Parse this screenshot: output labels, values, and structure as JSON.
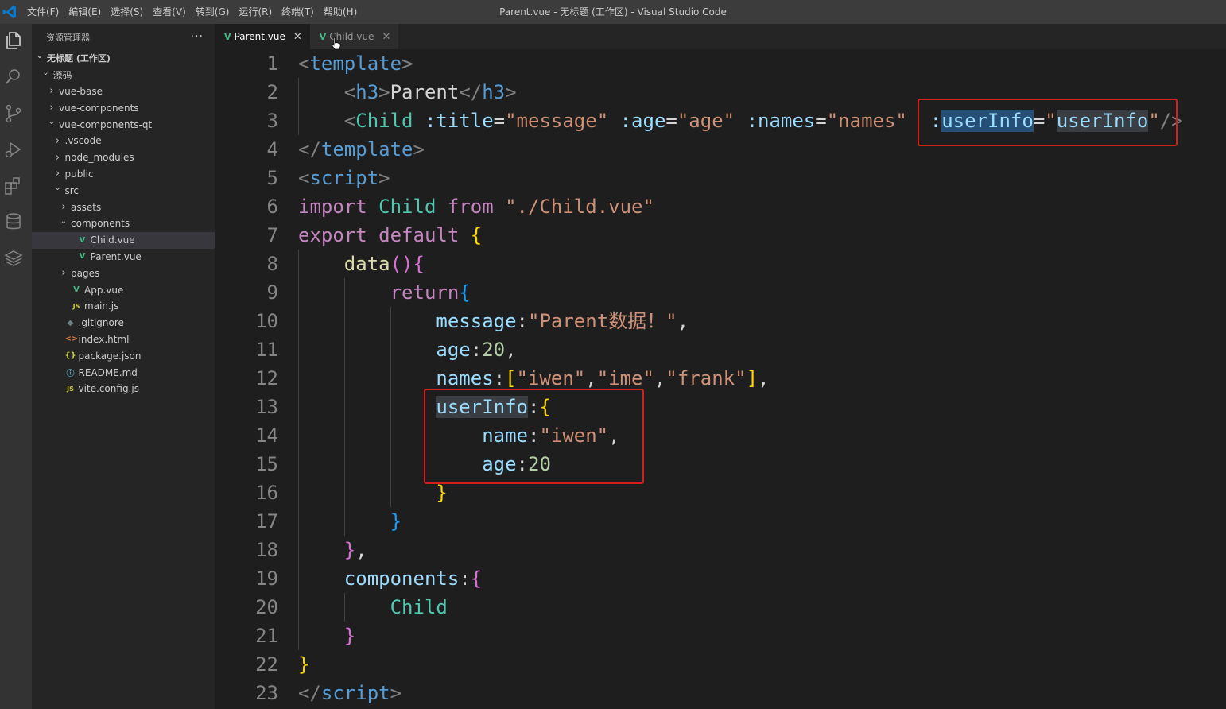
{
  "window": {
    "title": "Parent.vue - 无标题 (工作区) - Visual Studio Code"
  },
  "menu": [
    "文件(F)",
    "编辑(E)",
    "选择(S)",
    "查看(V)",
    "转到(G)",
    "运行(R)",
    "终端(T)",
    "帮助(H)"
  ],
  "activity_icons": [
    "explorer-icon",
    "search-icon",
    "source-control-icon",
    "run-debug-icon",
    "extensions-icon",
    "database-icon",
    "layers-icon"
  ],
  "sidebar": {
    "header": "资源管理器",
    "more": "···",
    "tree": [
      {
        "label": "无标题 (工作区)",
        "indent": 0,
        "chevron": "open",
        "icon": "",
        "bold": true
      },
      {
        "label": "源码",
        "indent": 1,
        "chevron": "open",
        "icon": ""
      },
      {
        "label": "vue-base",
        "indent": 2,
        "chevron": "closed",
        "icon": ""
      },
      {
        "label": "vue-components",
        "indent": 2,
        "chevron": "closed",
        "icon": ""
      },
      {
        "label": "vue-components-qt",
        "indent": 2,
        "chevron": "open",
        "icon": ""
      },
      {
        "label": ".vscode",
        "indent": 3,
        "chevron": "closed",
        "icon": ""
      },
      {
        "label": "node_modules",
        "indent": 3,
        "chevron": "closed",
        "icon": ""
      },
      {
        "label": "public",
        "indent": 3,
        "chevron": "closed",
        "icon": ""
      },
      {
        "label": "src",
        "indent": 3,
        "chevron": "open",
        "icon": ""
      },
      {
        "label": "assets",
        "indent": 4,
        "chevron": "closed",
        "icon": ""
      },
      {
        "label": "components",
        "indent": 4,
        "chevron": "open",
        "icon": ""
      },
      {
        "label": "Child.vue",
        "indent": 5,
        "chevron": "none",
        "icon": "vue",
        "selected": true
      },
      {
        "label": "Parent.vue",
        "indent": 5,
        "chevron": "none",
        "icon": "vue"
      },
      {
        "label": "pages",
        "indent": 4,
        "chevron": "closed",
        "icon": ""
      },
      {
        "label": "App.vue",
        "indent": 4,
        "chevron": "none",
        "icon": "vue"
      },
      {
        "label": "main.js",
        "indent": 4,
        "chevron": "none",
        "icon": "js"
      },
      {
        "label": ".gitignore",
        "indent": 3,
        "chevron": "none",
        "icon": "git"
      },
      {
        "label": "index.html",
        "indent": 3,
        "chevron": "none",
        "icon": "html"
      },
      {
        "label": "package.json",
        "indent": 3,
        "chevron": "none",
        "icon": "json"
      },
      {
        "label": "README.md",
        "indent": 3,
        "chevron": "none",
        "icon": "info"
      },
      {
        "label": "vite.config.js",
        "indent": 3,
        "chevron": "none",
        "icon": "vite"
      }
    ]
  },
  "icon_glyphs": {
    "vue": "V",
    "js": "JS",
    "json": "{}",
    "html": "<>",
    "git": "◆",
    "info": "ⓘ",
    "vite": "JS"
  },
  "tabs": [
    {
      "label": "Parent.vue",
      "active": true,
      "close": "✕"
    },
    {
      "label": "Child.vue",
      "active": false,
      "close": "✕"
    }
  ],
  "editor": {
    "lines": [
      {
        "n": "1",
        "tokens": [
          [
            "punc",
            "<"
          ],
          [
            "tag",
            "template"
          ],
          [
            "punc",
            ">"
          ]
        ]
      },
      {
        "n": "2",
        "tokens": [
          [
            "txt",
            "    "
          ],
          [
            "punc",
            "<"
          ],
          [
            "tag",
            "h3"
          ],
          [
            "punc",
            ">"
          ],
          [
            "txt",
            "Parent"
          ],
          [
            "punc",
            "</"
          ],
          [
            "tag",
            "h3"
          ],
          [
            "punc",
            ">"
          ]
        ]
      },
      {
        "n": "3",
        "tokens": [
          [
            "txt",
            "    "
          ],
          [
            "punc",
            "<"
          ],
          [
            "comp",
            "Child"
          ],
          [
            "txt",
            " "
          ],
          [
            "attr",
            ":title"
          ],
          [
            "txt",
            "="
          ],
          [
            "str",
            "\"message\""
          ],
          [
            "txt",
            " "
          ],
          [
            "attr",
            ":age"
          ],
          [
            "txt",
            "="
          ],
          [
            "str",
            "\"age\""
          ],
          [
            "txt",
            " "
          ],
          [
            "attr",
            ":names"
          ],
          [
            "txt",
            "="
          ],
          [
            "str",
            "\"names\""
          ],
          [
            "txt",
            "  "
          ],
          [
            "attr",
            ":"
          ],
          [
            "attr-sel",
            "userInfo"
          ],
          [
            "txt",
            "="
          ],
          [
            "str",
            "\""
          ],
          [
            "attr-word",
            "userInfo"
          ],
          [
            "str",
            "\""
          ],
          [
            "punc",
            "/>"
          ]
        ]
      },
      {
        "n": "4",
        "tokens": [
          [
            "punc",
            "</"
          ],
          [
            "tag",
            "template"
          ],
          [
            "punc",
            ">"
          ]
        ]
      },
      {
        "n": "5",
        "tokens": [
          [
            "punc",
            "<"
          ],
          [
            "tag",
            "script"
          ],
          [
            "punc",
            ">"
          ]
        ]
      },
      {
        "n": "6",
        "tokens": [
          [
            "kw",
            "import"
          ],
          [
            "txt",
            " "
          ],
          [
            "comp",
            "Child"
          ],
          [
            "txt",
            " "
          ],
          [
            "kw",
            "from"
          ],
          [
            "txt",
            " "
          ],
          [
            "str",
            "\"./Child.vue\""
          ]
        ]
      },
      {
        "n": "7",
        "tokens": [
          [
            "kw",
            "export"
          ],
          [
            "txt",
            " "
          ],
          [
            "kw",
            "default"
          ],
          [
            "txt",
            " "
          ],
          [
            "b1",
            "{"
          ]
        ]
      },
      {
        "n": "8",
        "tokens": [
          [
            "txt",
            "    "
          ],
          [
            "fn",
            "data"
          ],
          [
            "b2",
            "()"
          ],
          [
            "b2",
            "{"
          ]
        ]
      },
      {
        "n": "9",
        "tokens": [
          [
            "txt",
            "        "
          ],
          [
            "kw",
            "return"
          ],
          [
            "b3",
            "{"
          ]
        ]
      },
      {
        "n": "10",
        "tokens": [
          [
            "txt",
            "            "
          ],
          [
            "attr",
            "message"
          ],
          [
            "txt",
            ":"
          ],
          [
            "str",
            "\"Parent数据！\""
          ],
          [
            "txt",
            ","
          ]
        ]
      },
      {
        "n": "11",
        "tokens": [
          [
            "txt",
            "            "
          ],
          [
            "attr",
            "age"
          ],
          [
            "txt",
            ":"
          ],
          [
            "num",
            "20"
          ],
          [
            "txt",
            ","
          ]
        ]
      },
      {
        "n": "12",
        "tokens": [
          [
            "txt",
            "            "
          ],
          [
            "attr",
            "names"
          ],
          [
            "txt",
            ":"
          ],
          [
            "b1",
            "["
          ],
          [
            "str",
            "\"iwen\""
          ],
          [
            "txt",
            ","
          ],
          [
            "str",
            "\"ime\""
          ],
          [
            "txt",
            ","
          ],
          [
            "str",
            "\"frank\""
          ],
          [
            "b1",
            "]"
          ],
          [
            "txt",
            ","
          ]
        ]
      },
      {
        "n": "13",
        "tokens": [
          [
            "txt",
            "            "
          ],
          [
            "attr-word",
            "userInfo"
          ],
          [
            "txt",
            ":"
          ],
          [
            "b1",
            "{"
          ]
        ]
      },
      {
        "n": "14",
        "tokens": [
          [
            "txt",
            "                "
          ],
          [
            "attr",
            "name"
          ],
          [
            "txt",
            ":"
          ],
          [
            "str",
            "\"iwen\""
          ],
          [
            "txt",
            ","
          ]
        ]
      },
      {
        "n": "15",
        "tokens": [
          [
            "txt",
            "                "
          ],
          [
            "attr",
            "age"
          ],
          [
            "txt",
            ":"
          ],
          [
            "num",
            "20"
          ]
        ]
      },
      {
        "n": "16",
        "tokens": [
          [
            "txt",
            "            "
          ],
          [
            "b1",
            "}"
          ]
        ]
      },
      {
        "n": "17",
        "tokens": [
          [
            "txt",
            "        "
          ],
          [
            "b3",
            "}"
          ]
        ]
      },
      {
        "n": "18",
        "tokens": [
          [
            "txt",
            "    "
          ],
          [
            "b2",
            "}"
          ],
          [
            "txt",
            ","
          ]
        ]
      },
      {
        "n": "19",
        "tokens": [
          [
            "txt",
            "    "
          ],
          [
            "attr",
            "components"
          ],
          [
            "txt",
            ":"
          ],
          [
            "b2",
            "{"
          ]
        ]
      },
      {
        "n": "20",
        "tokens": [
          [
            "txt",
            "        "
          ],
          [
            "comp",
            "Child"
          ]
        ]
      },
      {
        "n": "21",
        "tokens": [
          [
            "txt",
            "    "
          ],
          [
            "b2",
            "}"
          ]
        ]
      },
      {
        "n": "22",
        "tokens": [
          [
            "b1",
            "}"
          ]
        ]
      },
      {
        "n": "23",
        "tokens": [
          [
            "punc",
            "</"
          ],
          [
            "tag",
            "script"
          ],
          [
            "punc",
            ">"
          ]
        ]
      }
    ]
  },
  "colors": {
    "highlight_box": "#d0211c",
    "vue_icon": "#41b883",
    "activity_bar": "#333333",
    "sidebar": "#252526",
    "editor": "#1e1e1e"
  }
}
